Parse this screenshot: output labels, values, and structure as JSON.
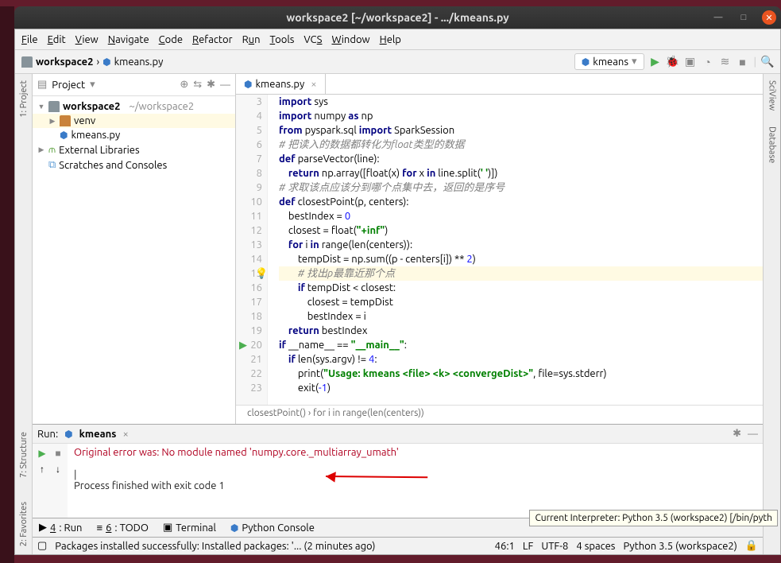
{
  "title": "workspace2 [~/workspace2] - .../kmeans.py",
  "menu": {
    "file": "File",
    "edit": "Edit",
    "view": "View",
    "nav": "Navigate",
    "code": "Code",
    "ref": "Refactor",
    "run": "Run",
    "tools": "Tools",
    "vcs": "VCS",
    "win": "Window",
    "help": "Help"
  },
  "crumb": {
    "root": "workspace2",
    "file": "kmeans.py"
  },
  "runconfig": "kmeans",
  "project": {
    "title": "Project",
    "root": "workspace2",
    "rootpath": "~/workspace2",
    "venv": "venv",
    "file": "kmeans.py",
    "extlib": "External Libraries",
    "scratch": "Scratches and Consoles"
  },
  "editor": {
    "tab": "kmeans.py",
    "lines": [
      {
        "n": 3,
        "html": "<span class='kw'>import</span> sys"
      },
      {
        "n": 4,
        "html": "<span class='kw'>import</span> numpy <span class='kw'>as</span> np"
      },
      {
        "n": 5,
        "html": "<span class='kw'>from</span> pyspark.sql <span class='kw'>import</span> SparkSession"
      },
      {
        "n": 6,
        "html": "<span class='cmt'># 把读入的数据都转化为float类型的数据</span>"
      },
      {
        "n": 7,
        "html": "<span class='kw'>def</span> parseVector(line):"
      },
      {
        "n": 8,
        "html": "    <span class='kw'>return</span> np.array([float(x) <span class='kw'>for</span> x <span class='kw'>in</span> line.split(<span class='str'>' '</span>)])"
      },
      {
        "n": 9,
        "html": "<span class='cmt'># 求取该点应该分到哪个点集中去，返回的是序号</span>"
      },
      {
        "n": 10,
        "html": "<span class='kw'>def</span> closestPoint(p, centers):"
      },
      {
        "n": 11,
        "html": "    bestIndex = <span class='num'>0</span>"
      },
      {
        "n": 12,
        "html": "    closest = float(<span class='str'>\"+inf\"</span>)"
      },
      {
        "n": 13,
        "html": "    <span class='kw'>for</span> i <span class='kw'>in</span> range(len(centers)):"
      },
      {
        "n": 14,
        "html": "        tempDist = np.sum((p - centers[i]) ** <span class='num'>2</span>)"
      },
      {
        "n": 15,
        "html": "        <span class='cmt'># 找出p最靠近那个点</span>",
        "hl": true,
        "bulb": true
      },
      {
        "n": 16,
        "html": "        <span class='kw'>if</span> tempDist &lt; closest:"
      },
      {
        "n": 17,
        "html": "            closest = tempDist"
      },
      {
        "n": 18,
        "html": "            bestIndex = i"
      },
      {
        "n": 19,
        "html": "    <span class='kw'>return</span> bestIndex"
      },
      {
        "n": 20,
        "html": "<span class='kw'>if</span> __name__ == <span class='str'>\"__main__\"</span>:",
        "play": true
      },
      {
        "n": 21,
        "html": "    <span class='kw'>if</span> len(sys.argv) != <span class='num'>4</span>:"
      },
      {
        "n": 22,
        "html": "        print(<span class='str'>\"Usage: kmeans &lt;file&gt; &lt;k&gt; &lt;convergeDist&gt;\"</span>, file=sys.stderr)"
      },
      {
        "n": 23,
        "html": "        exit(<span class='num'>-1</span>)"
      }
    ],
    "breadcrumb": "closestPoint()  ›  for i in range(len(centers))"
  },
  "run": {
    "title": "Run:",
    "config": "kmeans",
    "err": "Original error was: No module named 'numpy.core._multiarray_umath'",
    "exit": "Process finished with exit code 1"
  },
  "bottom": {
    "run": "4: Run",
    "todo": "6: TODO",
    "term": "Terminal",
    "pycon": "Python Console"
  },
  "status": {
    "msg": "Packages installed successfully: Installed packages: '... (2 minutes ago)",
    "pos": "46:1",
    "le": "LF",
    "enc": "UTF-8",
    "indent": "4 spaces",
    "interp": "Python 3.5 (workspace2)"
  },
  "tooltip": "Current Interpreter: Python 3.5 (workspace2) [/bin/pyth",
  "sidebars": {
    "proj": "1: Project",
    "struct": "7: Structure",
    "fav": "2: Favorites",
    "sci": "SciView",
    "db": "Database"
  }
}
